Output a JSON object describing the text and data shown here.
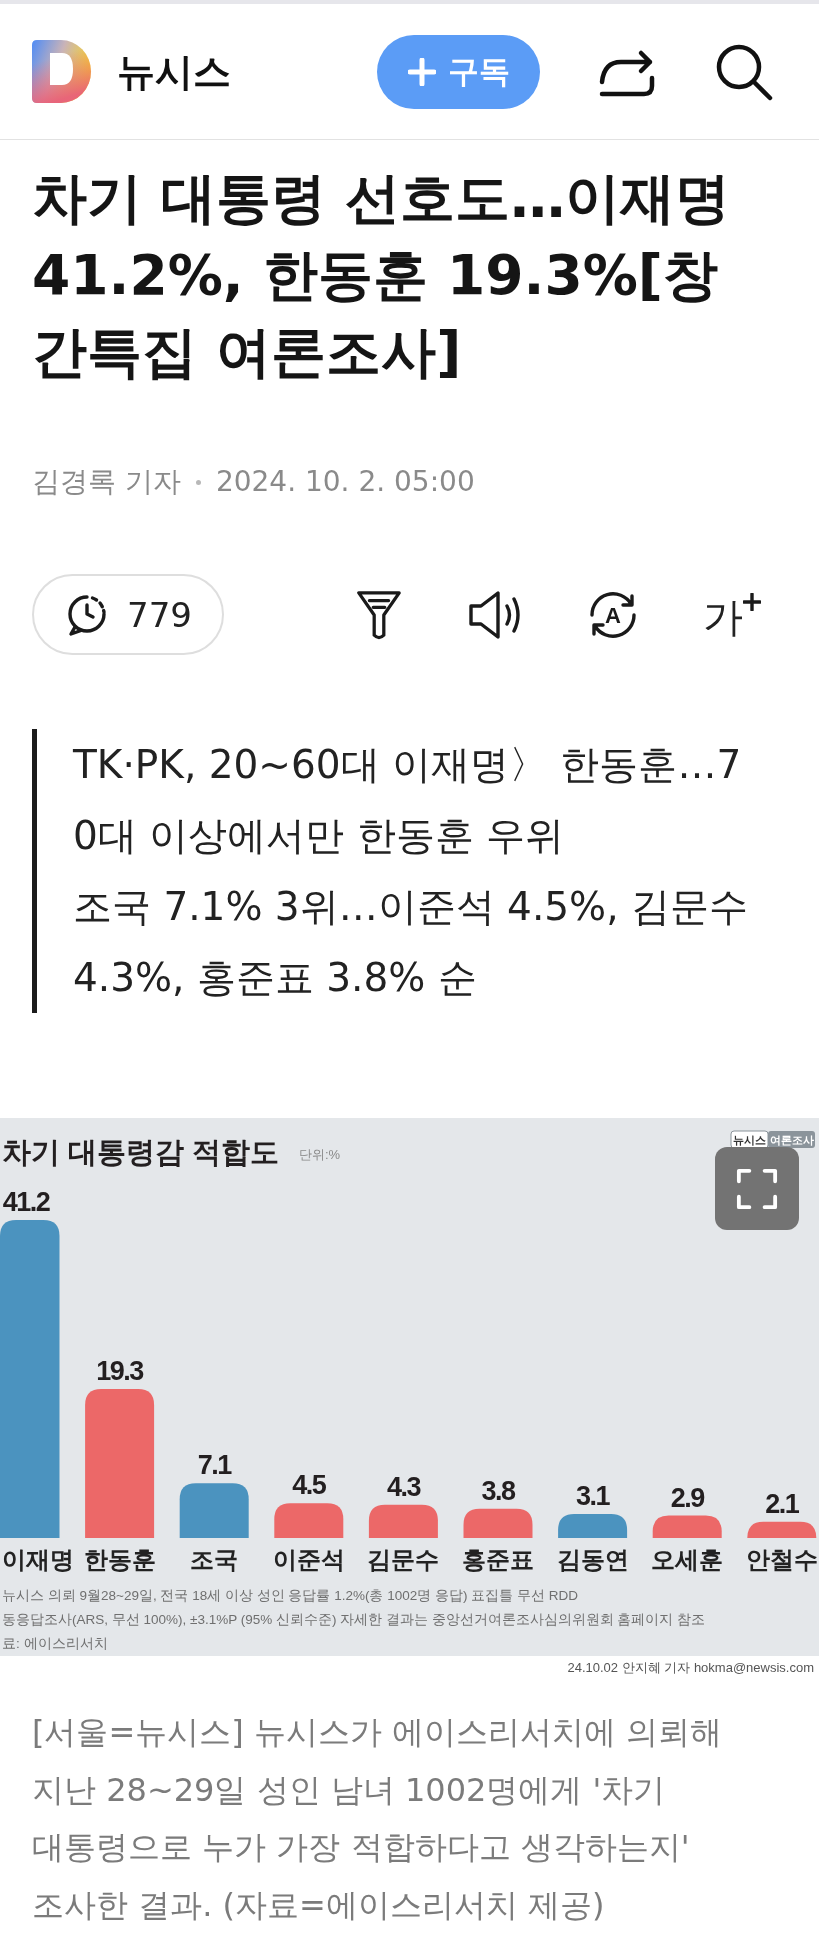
{
  "header": {
    "logo_text": "뉴시스",
    "subscribe_button": "구독",
    "actions": [
      {
        "kind": "share"
      },
      {
        "kind": "search"
      }
    ]
  },
  "article": {
    "title": "차기 대통령 선호도…이재명 41.2%, 한동훈 19.3%[창간특집 여론조사]",
    "author": "김경록 기자",
    "date": "2024. 10. 2. 05:00"
  },
  "toolbar": {
    "comment_count": "779",
    "tools": [
      {
        "kind": "filter"
      },
      {
        "kind": "speaker"
      },
      {
        "kind": "translate",
        "glyph": "A"
      },
      {
        "kind": "font_size",
        "glyph": "가"
      }
    ]
  },
  "summary": [
    "TK·PK, 20~60대 이재명〉 한동훈…70대 이상에서만 한동훈 우위",
    "조국 7.1% 3위…이준석 4.5%, 김문수 4.3%, 홍준표 3.8% 순"
  ],
  "figure": {
    "chart_data": {
      "type": "bar",
      "title": "차기 대통령감 적합도",
      "categories": [
        "이재명",
        "한동훈",
        "조국",
        "이준석",
        "김문수",
        "홍준표",
        "김동연",
        "오세훈",
        "안철수"
      ],
      "series": [
        {
          "color": "#4b93bf",
          "values": [
            41.2,
            null,
            7.1,
            null,
            null,
            null,
            3.1,
            null,
            null
          ]
        },
        {
          "color": "#ec6868",
          "values": [
            null,
            19.3,
            null,
            4.5,
            4.3,
            3.8,
            null,
            2.9,
            2.1
          ]
        }
      ],
      "stacked": true,
      "data_labels": true
    },
    "unit": "단위:%",
    "badge": [
      "뉴시스",
      "여론조사"
    ],
    "notes": [
      "뉴시스 의뢰 9월28~29일, 전국 18세 이상 성인 응답률 1.2%(총 1002명 응답) 표집틀 무선 RDD",
      "동응답조사(ARS, 무선 100%), ±3.1%P (95% 신뢰수준) 자세한 결과는 중앙선거여론조사심의위원회 홈페이지 참조",
      "료: 에이스리서치"
    ],
    "credit": "24.10.02 안지혜 기자 hokma@newsis.com"
  },
  "caption": "[서울=뉴시스] 뉴시스가 에이스리서치에 의뢰해 지난 28~29일 성인 남녀 1002명에게 '차기 대통령으로 누가 가장 적합하다고 생각하는지' 조사한 결과. (자료=에이스리서치 제공)"
}
